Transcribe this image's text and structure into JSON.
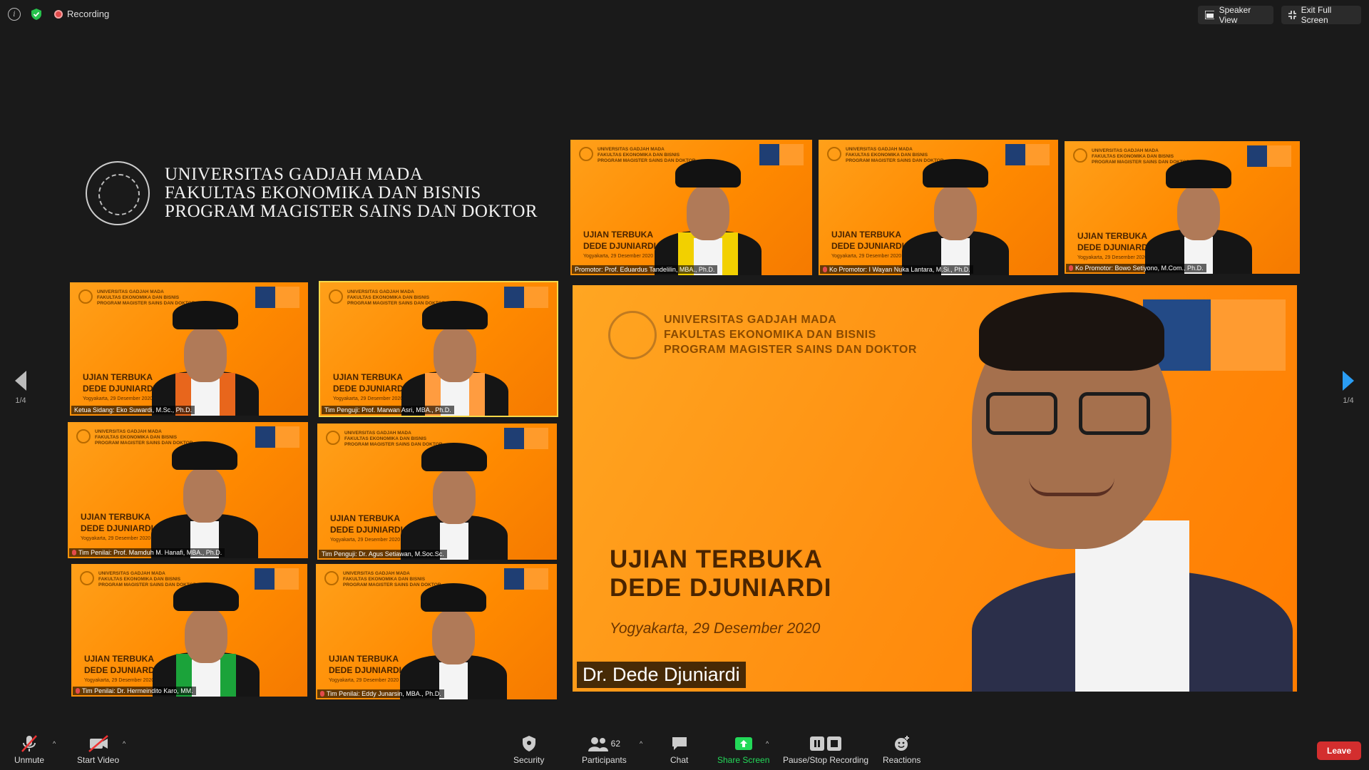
{
  "topbar": {
    "recording_label": "Recording",
    "speaker_view_label": "Speaker View",
    "exit_fullscreen_label": "Exit Full Screen"
  },
  "banner": {
    "line1": "UNIVERSITAS GADJAH MADA",
    "line2": "FAKULTAS EKONOMIKA DAN BISNIS",
    "line3": "PROGRAM MAGISTER SAINS DAN DOKTOR"
  },
  "pagination": {
    "left": "1/4",
    "right": "1/4"
  },
  "background_text": {
    "header": "UNIVERSITAS GADJAH MADA\nFAKULTAS EKONOMIKA DAN BISNIS\nPROGRAM MAGISTER SAINS DAN DOKTOR",
    "title": "UJIAN TERBUKA\nDEDE DJUNIARDI",
    "date": "Yogyakarta, 29 Desember 2020"
  },
  "participants": [
    {
      "name": "Promotor: Prof. Eduardus Tandelilin, MBA., Ph.D.",
      "muted": false
    },
    {
      "name": "Ko Promotor: I Wayan Nuka Lantara, M.Si., Ph.D.",
      "muted": true
    },
    {
      "name": "Ko Promotor: Bowo Setiyono, M.Com., Ph.D.",
      "muted": true
    },
    {
      "name": "Ketua Sidang: Eko Suwardi, M.Sc., Ph.D.",
      "muted": false
    },
    {
      "name": "Tim Penguji: Prof. Marwan Asri, MBA., Ph.D.",
      "muted": false
    },
    {
      "name": "Tim Penilai: Prof. Mamduh M. Hanafi, MBA., Ph.D.",
      "muted": true
    },
    {
      "name": "Tim Penguji: Dr. Agus Setiawan, M.Soc.Sc.",
      "muted": false
    },
    {
      "name": "Tim Penilai: Dr. Hermeindito Karo, MM.",
      "muted": true
    },
    {
      "name": "Tim Penilai: Eddy Junarsin, MBA., Ph.D.",
      "muted": true
    }
  ],
  "main_speaker": {
    "header": "UNIVERSITAS GADJAH MADA\nFAKULTAS EKONOMIKA DAN BISNIS\nPROGRAM MAGISTER SAINS DAN DOKTOR",
    "title": "UJIAN TERBUKA\nDEDE DJUNIARDI",
    "date": "Yogyakarta, 29 Desember 2020",
    "name": "Dr. Dede Djuniardi"
  },
  "toolbar": {
    "unmute": "Unmute",
    "start_video": "Start Video",
    "security": "Security",
    "participants": "Participants",
    "participants_count": "62",
    "chat": "Chat",
    "share_screen": "Share Screen",
    "pause_recording": "Pause/Stop Recording",
    "reactions": "Reactions",
    "leave": "Leave"
  },
  "colors": {
    "share_green": "#23d959",
    "leave_red": "#d32e2e",
    "nav_blue": "#2a9df4",
    "shield_green": "#27c24c"
  }
}
